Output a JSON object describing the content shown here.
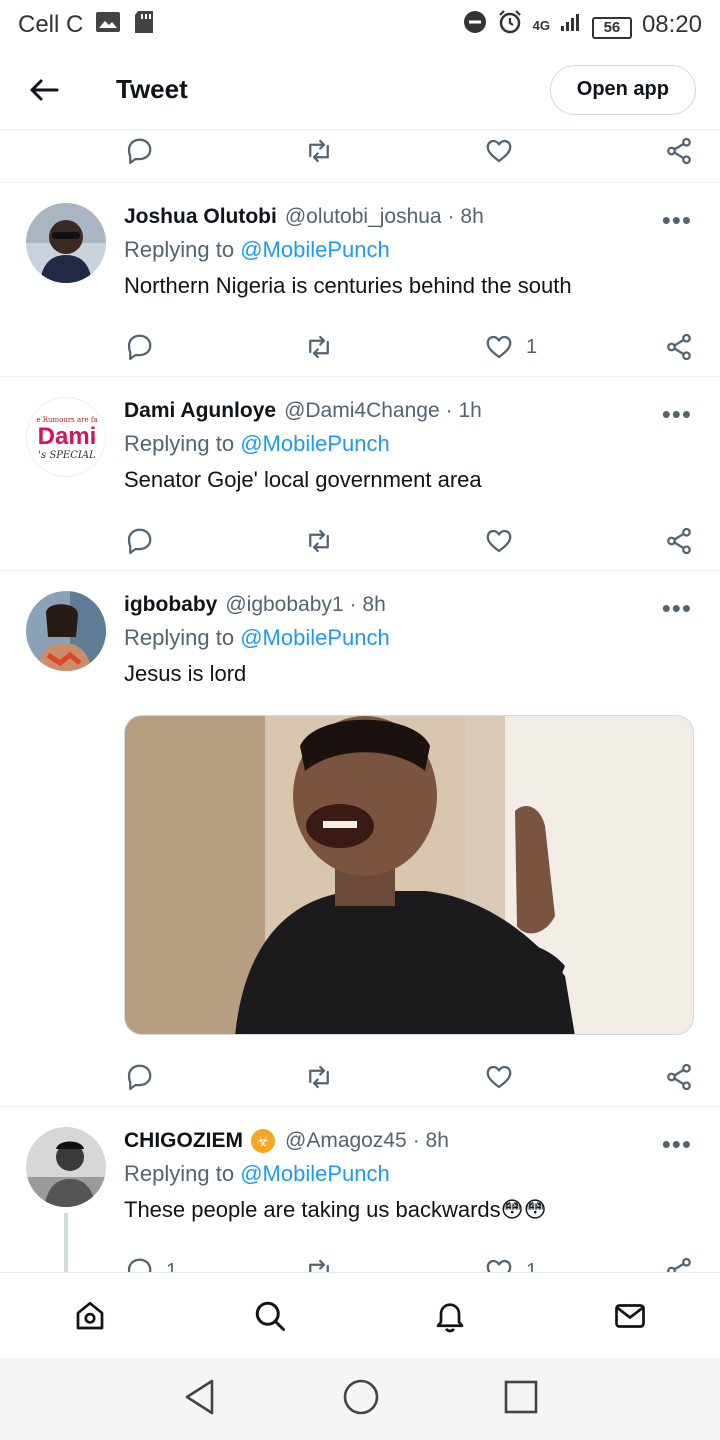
{
  "status_bar": {
    "carrier": "Cell C",
    "network": "4G",
    "battery": "56",
    "time": "08:20"
  },
  "header": {
    "title": "Tweet",
    "open_app_label": "Open app"
  },
  "top_actions": {
    "icons": [
      "reply-icon",
      "retweet-icon",
      "like-icon",
      "share-icon"
    ]
  },
  "tweets": [
    {
      "name": "Joshua Olutobi",
      "handle": "@olutobi_joshua",
      "time": "· 8h",
      "replying_prefix": "Replying to",
      "replying_to": "@MobilePunch",
      "text": "Northern Nigeria is centuries behind the south",
      "reply_count": "",
      "retweet_count": "",
      "like_count": "1"
    },
    {
      "name": "Dami Agunloye",
      "handle": "@Dami4Change",
      "time": "· 1h",
      "replying_prefix": "Replying to",
      "replying_to": "@MobilePunch",
      "text": "Senator Goje' local government area",
      "avatar_text": "Dami",
      "avatar_small_top": "e Rumours are fa",
      "avatar_small_bottom": "'s SPECIAL",
      "reply_count": "",
      "retweet_count": "",
      "like_count": ""
    },
    {
      "name": "igbobaby",
      "handle": "@igbobaby1",
      "time": "· 8h",
      "replying_prefix": "Replying to",
      "replying_to": "@MobilePunch",
      "text": "Jesus is lord",
      "has_media": true,
      "reply_count": "",
      "retweet_count": "",
      "like_count": ""
    },
    {
      "name": "CHIGOZIEM",
      "badge_icon": "☣",
      "handle": "@Amagoz45",
      "time": "· 8h",
      "replying_prefix": "Replying to",
      "replying_to": "@MobilePunch",
      "text": "These people are taking us backwards😳😳",
      "reply_count": "1",
      "retweet_count": "",
      "like_count": "1"
    }
  ],
  "bottom_nav": [
    "home-icon",
    "search-icon",
    "notifications-icon",
    "messages-icon"
  ],
  "system_nav": [
    "back-triangle-icon",
    "home-circle-icon",
    "recents-square-icon"
  ],
  "colors": {
    "accent": "#1d9bf0",
    "secondary_text": "#536471",
    "primary_text": "#0f1419"
  }
}
